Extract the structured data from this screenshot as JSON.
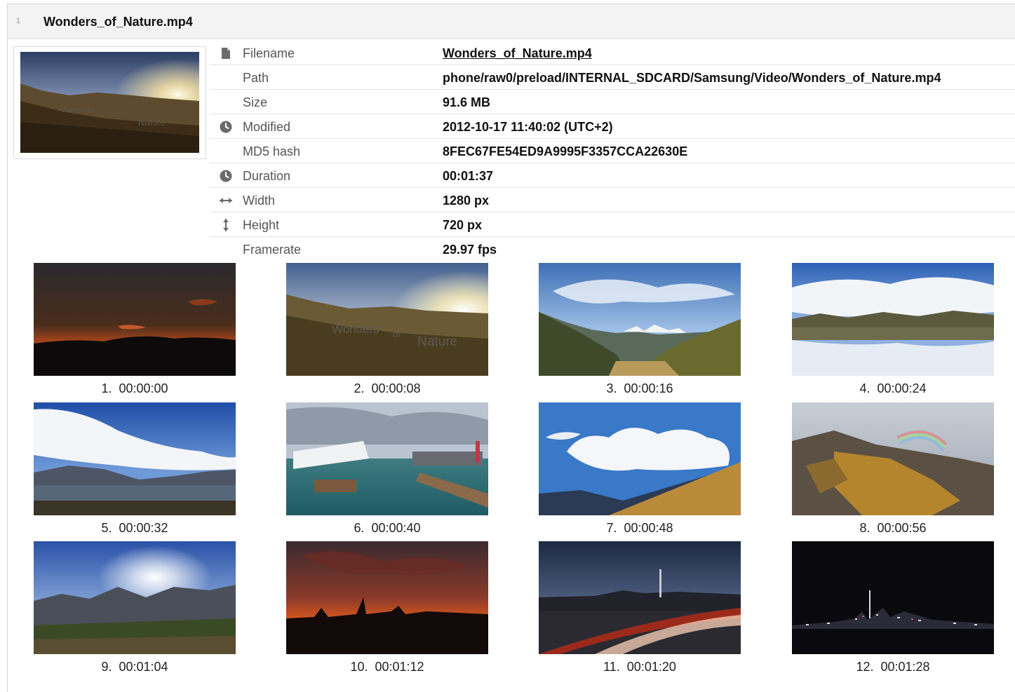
{
  "header": {
    "row_number": "1",
    "title": "Wonders_of_Nature.mp4"
  },
  "preview": {
    "overlay_words": [
      "Wonders",
      "of",
      "Nature"
    ]
  },
  "metadata": [
    {
      "icon": "file-icon",
      "label": "Filename",
      "value": "Wonders_of_Nature.mp4",
      "link": true
    },
    {
      "icon": "",
      "label": "Path",
      "value": "phone/raw0/preload/INTERNAL_SDCARD/Samsung/Video/Wonders_of_Nature.mp4"
    },
    {
      "icon": "",
      "label": "Size",
      "value": "91.6 MB"
    },
    {
      "icon": "clock-icon",
      "label": "Modified",
      "value": "2012-10-17 11:40:02 (UTC+2)"
    },
    {
      "icon": "",
      "label": "MD5 hash",
      "value": "8FEC67FE54ED9A9995F3357CCA22630E"
    },
    {
      "icon": "clock-icon",
      "label": "Duration",
      "value": "00:01:37"
    },
    {
      "icon": "width-arrows-icon",
      "label": "Width",
      "value": "1280 px"
    },
    {
      "icon": "height-arrows-icon",
      "label": "Height",
      "value": "720 px"
    },
    {
      "icon": "",
      "label": "Framerate",
      "value": "29.97 fps"
    }
  ],
  "thumbnails": [
    {
      "num": "1.",
      "time": "00:00:00"
    },
    {
      "num": "2.",
      "time": "00:00:08"
    },
    {
      "num": "3.",
      "time": "00:00:16"
    },
    {
      "num": "4.",
      "time": "00:00:24"
    },
    {
      "num": "5.",
      "time": "00:00:32"
    },
    {
      "num": "6.",
      "time": "00:00:40"
    },
    {
      "num": "7.",
      "time": "00:00:48"
    },
    {
      "num": "8.",
      "time": "00:00:56"
    },
    {
      "num": "9.",
      "time": "00:01:04"
    },
    {
      "num": "10.",
      "time": "00:01:12"
    },
    {
      "num": "11.",
      "time": "00:01:20"
    },
    {
      "num": "12.",
      "time": "00:01:28"
    }
  ],
  "colors": {
    "header_bg": "#f3f3f3",
    "icon": "#666666",
    "border": "#e2e2e2"
  }
}
